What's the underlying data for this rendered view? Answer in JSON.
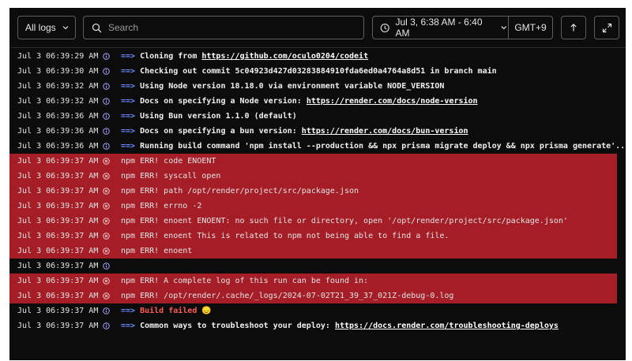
{
  "toolbar": {
    "log_filter": "All logs",
    "search_placeholder": "Search",
    "time_range": "Jul 3, 6:38 AM - 6:40 AM",
    "timezone": "GMT+9"
  },
  "colors": {
    "background": "#0c0c0c",
    "error_row": "#a51d26",
    "info_icon": "#a3a7ff",
    "arrow": "#6b8cff",
    "failed": "#ff5a52"
  },
  "log_lines": [
    {
      "ts": "Jul 3 06:39:29 AM",
      "level": "info",
      "parts": [
        {
          "t": "==> ",
          "s": "arrow"
        },
        {
          "t": "Cloning from ",
          "s": "bold"
        },
        {
          "t": "https://github.com/oculo0204/codeit",
          "s": "link"
        }
      ]
    },
    {
      "ts": "Jul 3 06:39:30 AM",
      "level": "info",
      "parts": [
        {
          "t": "==> ",
          "s": "arrow"
        },
        {
          "t": "Checking out commit 5c04923d427d03283884910fda6ed0a4764a8d51 in branch main",
          "s": "bold"
        }
      ]
    },
    {
      "ts": "Jul 3 06:39:32 AM",
      "level": "info",
      "parts": [
        {
          "t": "==> ",
          "s": "arrow"
        },
        {
          "t": "Using Node version 18.18.0 via environment variable NODE_VERSION",
          "s": "bold"
        }
      ]
    },
    {
      "ts": "Jul 3 06:39:32 AM",
      "level": "info",
      "parts": [
        {
          "t": "==> ",
          "s": "arrow"
        },
        {
          "t": "Docs on specifying a Node version: ",
          "s": "bold"
        },
        {
          "t": "https://render.com/docs/node-version",
          "s": "link"
        }
      ]
    },
    {
      "ts": "Jul 3 06:39:36 AM",
      "level": "info",
      "parts": [
        {
          "t": "==> ",
          "s": "arrow"
        },
        {
          "t": "Using Bun version 1.1.0 (default)",
          "s": "bold"
        }
      ]
    },
    {
      "ts": "Jul 3 06:39:36 AM",
      "level": "info",
      "parts": [
        {
          "t": "==> ",
          "s": "arrow"
        },
        {
          "t": "Docs on specifying a bun version: ",
          "s": "bold"
        },
        {
          "t": "https://render.com/docs/bun-version",
          "s": "link"
        }
      ]
    },
    {
      "ts": "Jul 3 06:39:36 AM",
      "level": "info",
      "parts": [
        {
          "t": "==> ",
          "s": "arrow"
        },
        {
          "t": "Running build command 'npm install --production && npx prisma migrate deploy && npx prisma generate'...",
          "s": "bold"
        }
      ]
    },
    {
      "ts": "Jul 3 06:39:37 AM",
      "level": "error",
      "parts": [
        {
          "t": "npm ERR! code ENOENT",
          "s": ""
        }
      ]
    },
    {
      "ts": "Jul 3 06:39:37 AM",
      "level": "error",
      "parts": [
        {
          "t": "npm ERR! syscall open",
          "s": ""
        }
      ]
    },
    {
      "ts": "Jul 3 06:39:37 AM",
      "level": "error",
      "parts": [
        {
          "t": "npm ERR! path /opt/render/project/src/package.json",
          "s": ""
        }
      ]
    },
    {
      "ts": "Jul 3 06:39:37 AM",
      "level": "error",
      "parts": [
        {
          "t": "npm ERR! errno -2",
          "s": ""
        }
      ]
    },
    {
      "ts": "Jul 3 06:39:37 AM",
      "level": "error",
      "parts": [
        {
          "t": "npm ERR! enoent ENOENT: no such file or directory, open '/opt/render/project/src/package.json'",
          "s": ""
        }
      ]
    },
    {
      "ts": "Jul 3 06:39:37 AM",
      "level": "error",
      "parts": [
        {
          "t": "npm ERR! enoent This is related to npm not being able to find a file.",
          "s": ""
        }
      ]
    },
    {
      "ts": "Jul 3 06:39:37 AM",
      "level": "error",
      "parts": [
        {
          "t": "npm ERR! enoent",
          "s": ""
        }
      ]
    },
    {
      "ts": "Jul 3 06:39:37 AM",
      "level": "info",
      "parts": []
    },
    {
      "ts": "Jul 3 06:39:37 AM",
      "level": "error",
      "parts": [
        {
          "t": "npm ERR! A complete log of this run can be found in:",
          "s": ""
        }
      ]
    },
    {
      "ts": "Jul 3 06:39:37 AM",
      "level": "error",
      "parts": [
        {
          "t": "npm ERR!     /opt/render/.cache/_logs/2024-07-02T21_39_37_021Z-debug-0.log",
          "s": ""
        }
      ]
    },
    {
      "ts": "Jul 3 06:39:37 AM",
      "level": "info",
      "parts": [
        {
          "t": "==> ",
          "s": "arrow"
        },
        {
          "t": "Build failed 😞",
          "s": "failed"
        }
      ]
    },
    {
      "ts": "Jul 3 06:39:37 AM",
      "level": "info",
      "parts": [
        {
          "t": "==> ",
          "s": "arrow"
        },
        {
          "t": "Common ways to troubleshoot your deploy: ",
          "s": "bold"
        },
        {
          "t": "https://docs.render.com/troubleshooting-deploys",
          "s": "link"
        }
      ]
    }
  ]
}
